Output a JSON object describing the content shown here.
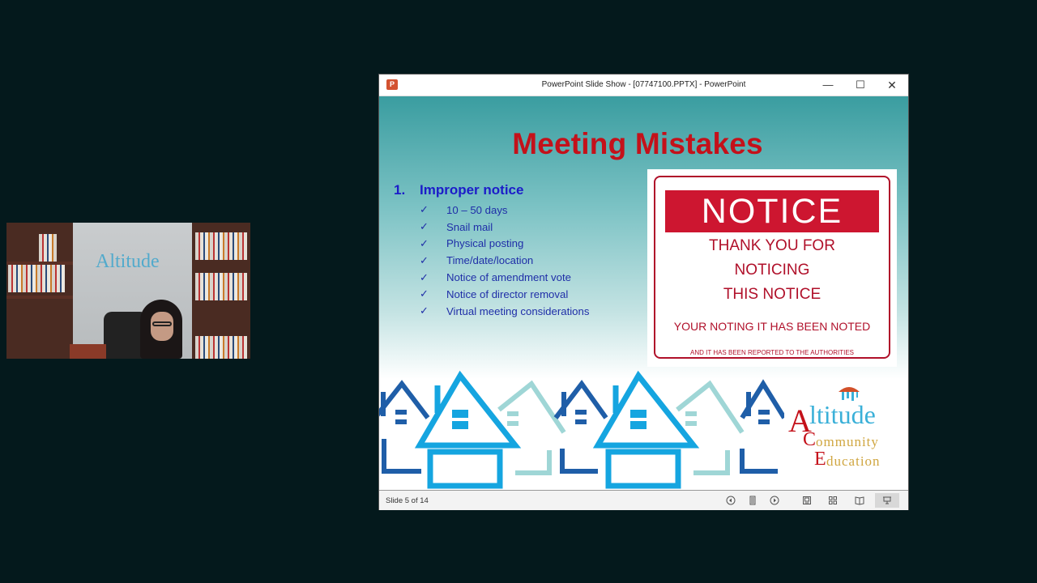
{
  "webcam": {
    "wall_logo_text": "Altitude"
  },
  "window": {
    "app_icon_label": "P",
    "title": "PowerPoint Slide Show - [07747100.PPTX] - PowerPoint",
    "minimize_glyph": "—",
    "maximize_glyph": "☐",
    "close_glyph": "✕"
  },
  "slide": {
    "title": "Meeting Mistakes",
    "list_number": "1.",
    "list_heading": "Improper notice",
    "check_glyph": "✓",
    "bullets": [
      "10 – 50 days",
      "Snail mail",
      "Physical posting",
      "Time/date/location",
      "Notice of amendment vote",
      "Notice of director removal",
      "Virtual meeting considerations"
    ],
    "notice": {
      "header": "NOTICE",
      "line1": "THANK YOU FOR",
      "line2": "NOTICING",
      "line3": "THIS NOTICE",
      "line4": "YOUR NOTING IT HAS BEEN NOTED",
      "line5": "AND IT HAS BEEN REPORTED TO THE AUTHORITIES"
    },
    "logo": {
      "a": "A",
      "ltitude": "ltitude",
      "c": "C",
      "ommunity": "ommunity",
      "e": "E",
      "ducation": "ducation"
    },
    "colors": {
      "title_red": "#c4111a",
      "list_blue": "#1f2ea8",
      "house_dark": "#1f5ea8",
      "house_mid": "#15a5e0",
      "house_light": "#9fd6d6"
    }
  },
  "statusbar": {
    "slide_counter": "Slide 5 of 14",
    "current_slide": 5,
    "total_slides": 14
  }
}
